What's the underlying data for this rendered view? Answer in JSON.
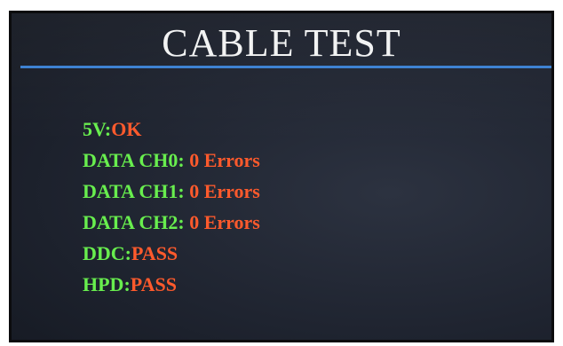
{
  "screen": {
    "title": "CABLE TEST",
    "accent_color": "#3a7fd1",
    "label_color": "#68ee4e",
    "value_color": "#ff5a2c",
    "rows": [
      {
        "label": "5V:",
        "value": "OK"
      },
      {
        "label": "DATA CH0:",
        "value": " 0 Errors"
      },
      {
        "label": "DATA CH1:",
        "value": " 0 Errors"
      },
      {
        "label": "DATA CH2:",
        "value": " 0 Errors"
      },
      {
        "label": "DDC:",
        "value": "PASS"
      },
      {
        "label": "HPD:",
        "value": "PASS"
      }
    ]
  }
}
